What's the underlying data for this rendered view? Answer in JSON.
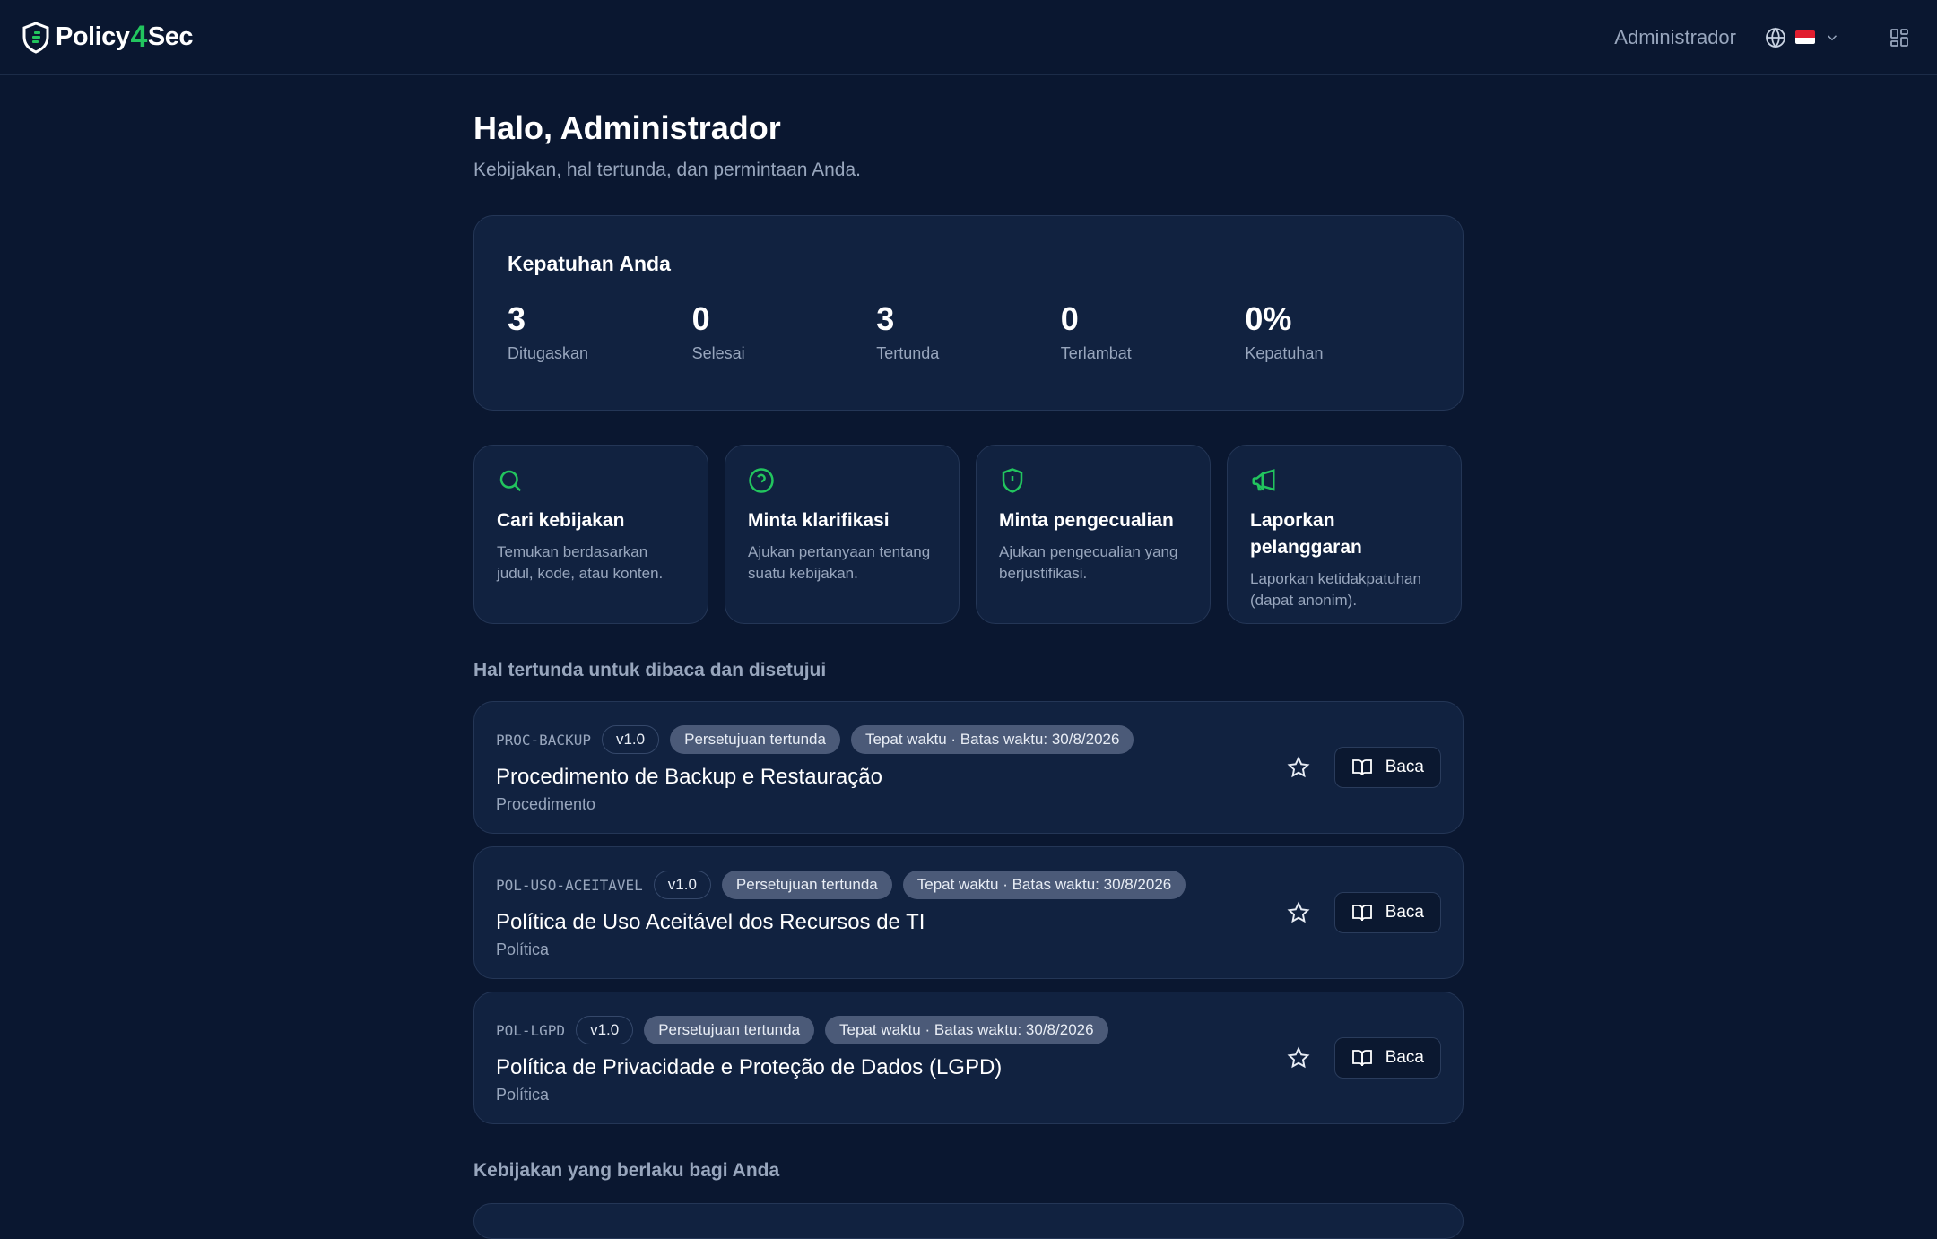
{
  "header": {
    "logo_text_left": "Policy",
    "logo_text_bolt": "4",
    "logo_text_right": "Sec",
    "user_name": "Administrador"
  },
  "greeting": "Halo, Administrador",
  "subtitle": "Kebijakan, hal tertunda, dan permintaan Anda.",
  "compliance": {
    "title": "Kepatuhan Anda",
    "stats": [
      {
        "value": "3",
        "label": "Ditugaskan"
      },
      {
        "value": "0",
        "label": "Selesai"
      },
      {
        "value": "3",
        "label": "Tertunda"
      },
      {
        "value": "0",
        "label": "Terlambat"
      },
      {
        "value": "0%",
        "label": "Kepatuhan"
      }
    ]
  },
  "actions": [
    {
      "icon": "search-icon",
      "title": "Cari kebijakan",
      "desc": "Temukan berdasarkan judul, kode, atau konten."
    },
    {
      "icon": "help-circle-icon",
      "title": "Minta klarifikasi",
      "desc": "Ajukan pertanyaan tentang suatu kebijakan."
    },
    {
      "icon": "shield-alert-icon",
      "title": "Minta pengecualian",
      "desc": "Ajukan pengecualian yang berjustifikasi."
    },
    {
      "icon": "megaphone-icon",
      "title": "Laporkan pelanggaran",
      "desc": "Laporkan ketidakpatuhan (dapat anonim)."
    }
  ],
  "pending_section_title": "Hal tertunda untuk dibaca dan disetujui",
  "pending": [
    {
      "code": "PROC-BACKUP",
      "version": "v1.0",
      "status": "Persetujuan tertunda",
      "deadline": "Tepat waktu · Batas waktu: 30/8/2026",
      "title": "Procedimento de Backup e Restauração",
      "type": "Procedimento",
      "read_label": "Baca"
    },
    {
      "code": "POL-USO-ACEITAVEL",
      "version": "v1.0",
      "status": "Persetujuan tertunda",
      "deadline": "Tepat waktu · Batas waktu: 30/8/2026",
      "title": "Política de Uso Aceitável dos Recursos de TI",
      "type": "Política",
      "read_label": "Baca"
    },
    {
      "code": "POL-LGPD",
      "version": "v1.0",
      "status": "Persetujuan tertunda",
      "deadline": "Tepat waktu · Batas waktu: 30/8/2026",
      "title": "Política de Privacidade e Proteção de Dados (LGPD)",
      "type": "Política",
      "read_label": "Baca"
    }
  ],
  "applicable_section_title": "Kebijakan yang berlaku bagi Anda",
  "colors": {
    "accent": "#22c55e",
    "background": "#0a1730",
    "card": "#112240",
    "pill": "#4b5a78"
  }
}
